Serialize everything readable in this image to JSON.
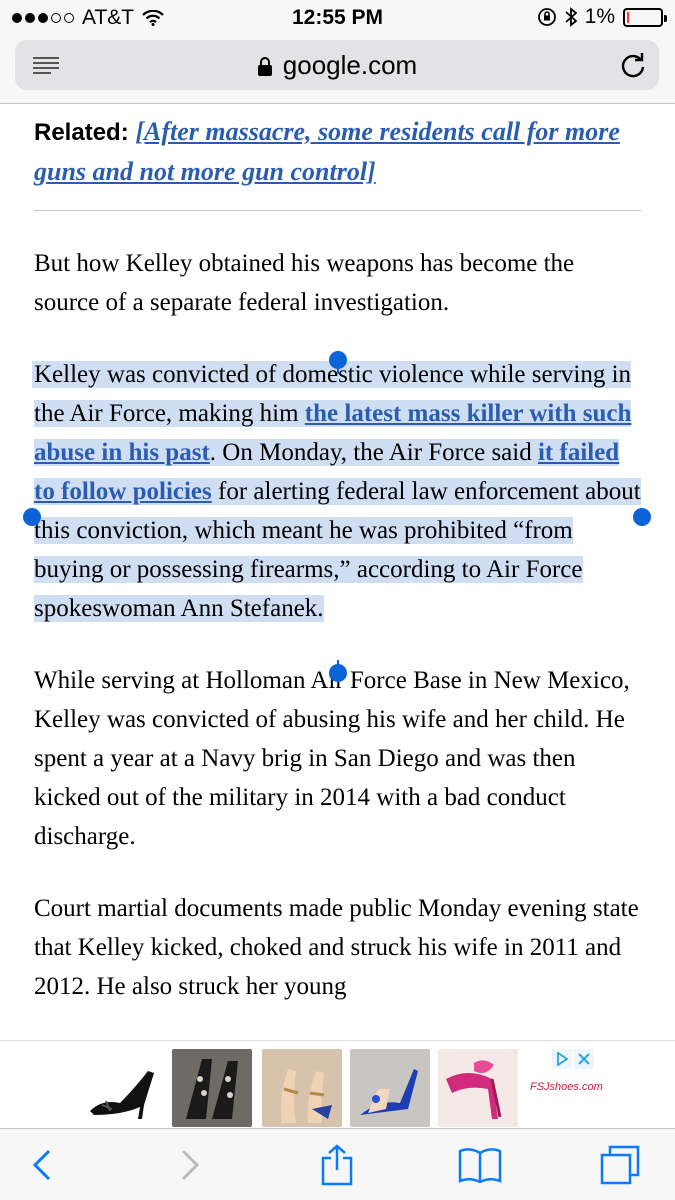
{
  "status_bar": {
    "carrier": "AT&T",
    "time": "12:55 PM",
    "battery": "1%",
    "battery_level": 0.01,
    "signal_bars_filled": 3,
    "signal_bars_total": 5
  },
  "browser": {
    "domain": "google.com",
    "icons": [
      "reader-icon",
      "lock-icon",
      "reload-icon"
    ]
  },
  "article": {
    "related_label": "Related:",
    "related_link": "[After massacre, some residents call for more guns and not more gun control]",
    "p1": "But how Kelley obtained his weapons has become the source of a separate federal investigation.",
    "p2": {
      "t1": "Kelley was convicted of domestic violence while serving in the Air Force, making him ",
      "link1": "the latest mass killer with such abuse in his past",
      "t2": ". On Monday, the Air Force said ",
      "link2": "it failed to follow policies",
      "t3": " for alerting federal law enforcement about this conviction, which meant he was prohibited “from buying or possessing firearms,” according to Air Force spokeswoman Ann Stefanek."
    },
    "p3": "While serving at Holloman Air Force Base in New Mexico, Kelley was convicted of abusing his wife and her child. He spent a year at a Navy brig in San Diego and was then kicked out of the military in 2014 with a bad conduct discharge.",
    "p4": "Court martial documents made public Monday evening state that Kelley kicked, choked and struck his wife in 2011 and 2012. He also struck her young"
  },
  "ad": {
    "brand": "FSJshoes.com"
  },
  "toolbar": {
    "icons": [
      "back-icon",
      "forward-icon",
      "share-icon",
      "bookmarks-icon",
      "tabs-icon"
    ]
  },
  "colors": {
    "link": "#2a5db0",
    "selection": "#0a64d8",
    "battery": "#ff3b30"
  }
}
